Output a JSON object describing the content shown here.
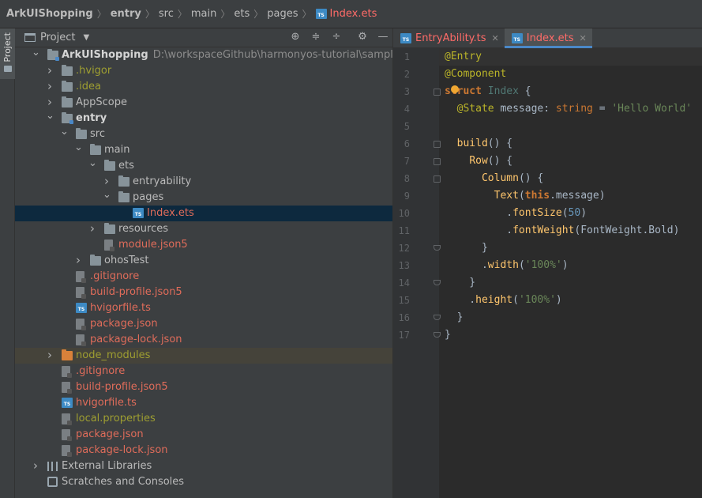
{
  "navbar": {
    "crumbs": [
      "ArkUIShopping",
      "entry",
      "src",
      "main",
      "ets",
      "pages",
      "Index.ets"
    ]
  },
  "toolstrip": {
    "project_label": "Project"
  },
  "project_panel": {
    "title": "Project",
    "tools": [
      "locate-icon",
      "expand-all-icon",
      "collapse-all-icon",
      "gear-icon",
      "minimize-icon"
    ],
    "tree": [
      {
        "label": "ArkUIShopping",
        "path": "D:\\workspaceGithub\\harmonyos-tutorial\\samples\\ArkUISh",
        "depth": 0,
        "expanded": true,
        "icon": "module-folder",
        "color": "bold"
      },
      {
        "label": ".hvigor",
        "depth": 1,
        "expanded": false,
        "icon": "folder",
        "color": "olive"
      },
      {
        "label": ".idea",
        "depth": 1,
        "expanded": false,
        "icon": "folder",
        "color": "olive"
      },
      {
        "label": "AppScope",
        "depth": 1,
        "expanded": false,
        "icon": "folder",
        "color": "default"
      },
      {
        "label": "entry",
        "depth": 1,
        "expanded": true,
        "icon": "module-folder",
        "color": "bold"
      },
      {
        "label": "src",
        "depth": 2,
        "expanded": true,
        "icon": "folder",
        "color": "default"
      },
      {
        "label": "main",
        "depth": 3,
        "expanded": true,
        "icon": "folder",
        "color": "default"
      },
      {
        "label": "ets",
        "depth": 4,
        "expanded": true,
        "icon": "folder",
        "color": "default"
      },
      {
        "label": "entryability",
        "depth": 5,
        "expanded": false,
        "icon": "folder",
        "color": "default"
      },
      {
        "label": "pages",
        "depth": 5,
        "expanded": true,
        "icon": "folder",
        "color": "default"
      },
      {
        "label": "Index.ets",
        "depth": 6,
        "icon": "ts-file",
        "color": "red",
        "selected": true
      },
      {
        "label": "resources",
        "depth": 4,
        "expanded": false,
        "icon": "folder",
        "color": "default"
      },
      {
        "label": "module.json5",
        "depth": 4,
        "icon": "file",
        "color": "red"
      },
      {
        "label": "ohosTest",
        "depth": 3,
        "expanded": false,
        "icon": "folder",
        "color": "default"
      },
      {
        "label": ".gitignore",
        "depth": 2,
        "icon": "file",
        "color": "red"
      },
      {
        "label": "build-profile.json5",
        "depth": 2,
        "icon": "file",
        "color": "red"
      },
      {
        "label": "hvigorfile.ts",
        "depth": 2,
        "icon": "ts-file",
        "color": "red"
      },
      {
        "label": "package.json",
        "depth": 2,
        "icon": "file",
        "color": "red"
      },
      {
        "label": "package-lock.json",
        "depth": 2,
        "icon": "file",
        "color": "red"
      },
      {
        "label": "node_modules",
        "depth": 1,
        "expanded": false,
        "icon": "orange-folder",
        "color": "olive",
        "excluded": true
      },
      {
        "label": ".gitignore",
        "depth": 1,
        "icon": "file",
        "color": "red"
      },
      {
        "label": "build-profile.json5",
        "depth": 1,
        "icon": "file",
        "color": "red"
      },
      {
        "label": "hvigorfile.ts",
        "depth": 1,
        "icon": "ts-file",
        "color": "red"
      },
      {
        "label": "local.properties",
        "depth": 1,
        "icon": "file",
        "color": "olive"
      },
      {
        "label": "package.json",
        "depth": 1,
        "icon": "file",
        "color": "red"
      },
      {
        "label": "package-lock.json",
        "depth": 1,
        "icon": "file",
        "color": "red"
      },
      {
        "label": "External Libraries",
        "depth": 0,
        "expanded": false,
        "icon": "library",
        "color": "default"
      },
      {
        "label": "Scratches and Consoles",
        "depth": 0,
        "icon": "scratch",
        "color": "default"
      }
    ]
  },
  "editor": {
    "tabs": [
      {
        "label": "EntryAbility.ts",
        "active": false
      },
      {
        "label": "Index.ets",
        "active": true
      }
    ],
    "lines": [
      [
        [
          "@Entry",
          "ann"
        ]
      ],
      [
        [
          "@Component",
          "ann"
        ]
      ],
      [
        [
          "struct ",
          "kw"
        ],
        [
          "Index ",
          "type"
        ],
        [
          "{",
          "cls"
        ]
      ],
      [
        [
          "  ",
          "cls"
        ],
        [
          "@State ",
          "ann"
        ],
        [
          "message",
          "cls"
        ],
        [
          ": ",
          "cls"
        ],
        [
          "string",
          "kw2"
        ],
        [
          " = ",
          "cls"
        ],
        [
          "'Hello World'",
          "str"
        ]
      ],
      [],
      [
        [
          "  ",
          "cls"
        ],
        [
          "build",
          "mth"
        ],
        [
          "() {",
          "cls"
        ]
      ],
      [
        [
          "    ",
          "cls"
        ],
        [
          "Row",
          "fn"
        ],
        [
          "() {",
          "cls"
        ]
      ],
      [
        [
          "      ",
          "cls"
        ],
        [
          "Column",
          "fn"
        ],
        [
          "() {",
          "cls"
        ]
      ],
      [
        [
          "        ",
          "cls"
        ],
        [
          "Text",
          "fn"
        ],
        [
          "(",
          "cls"
        ],
        [
          "this",
          "this"
        ],
        [
          ".message)",
          "cls"
        ]
      ],
      [
        [
          "          .",
          "cls"
        ],
        [
          "fontSize",
          "mth"
        ],
        [
          "(",
          "cls"
        ],
        [
          "50",
          "num"
        ],
        [
          ")",
          "cls"
        ]
      ],
      [
        [
          "          .",
          "cls"
        ],
        [
          "fontWeight",
          "mth"
        ],
        [
          "(FontWeight.Bold)",
          "cls"
        ]
      ],
      [
        [
          "      }",
          "cls"
        ]
      ],
      [
        [
          "      .",
          "cls"
        ],
        [
          "width",
          "mth"
        ],
        [
          "(",
          "cls"
        ],
        [
          "'100%'",
          "str"
        ],
        [
          ")",
          "cls"
        ]
      ],
      [
        [
          "    }",
          "cls"
        ]
      ],
      [
        [
          "    .",
          "cls"
        ],
        [
          "height",
          "mth"
        ],
        [
          "(",
          "cls"
        ],
        [
          "'100%'",
          "str"
        ],
        [
          ")",
          "cls"
        ]
      ],
      [
        [
          "  }",
          "cls"
        ]
      ],
      [
        [
          "}",
          "cls"
        ]
      ]
    ],
    "line_numbers": [
      "1",
      "2",
      "3",
      "4",
      "5",
      "6",
      "7",
      "8",
      "9",
      "10",
      "11",
      "12",
      "13",
      "14",
      "15",
      "16",
      "17"
    ]
  }
}
